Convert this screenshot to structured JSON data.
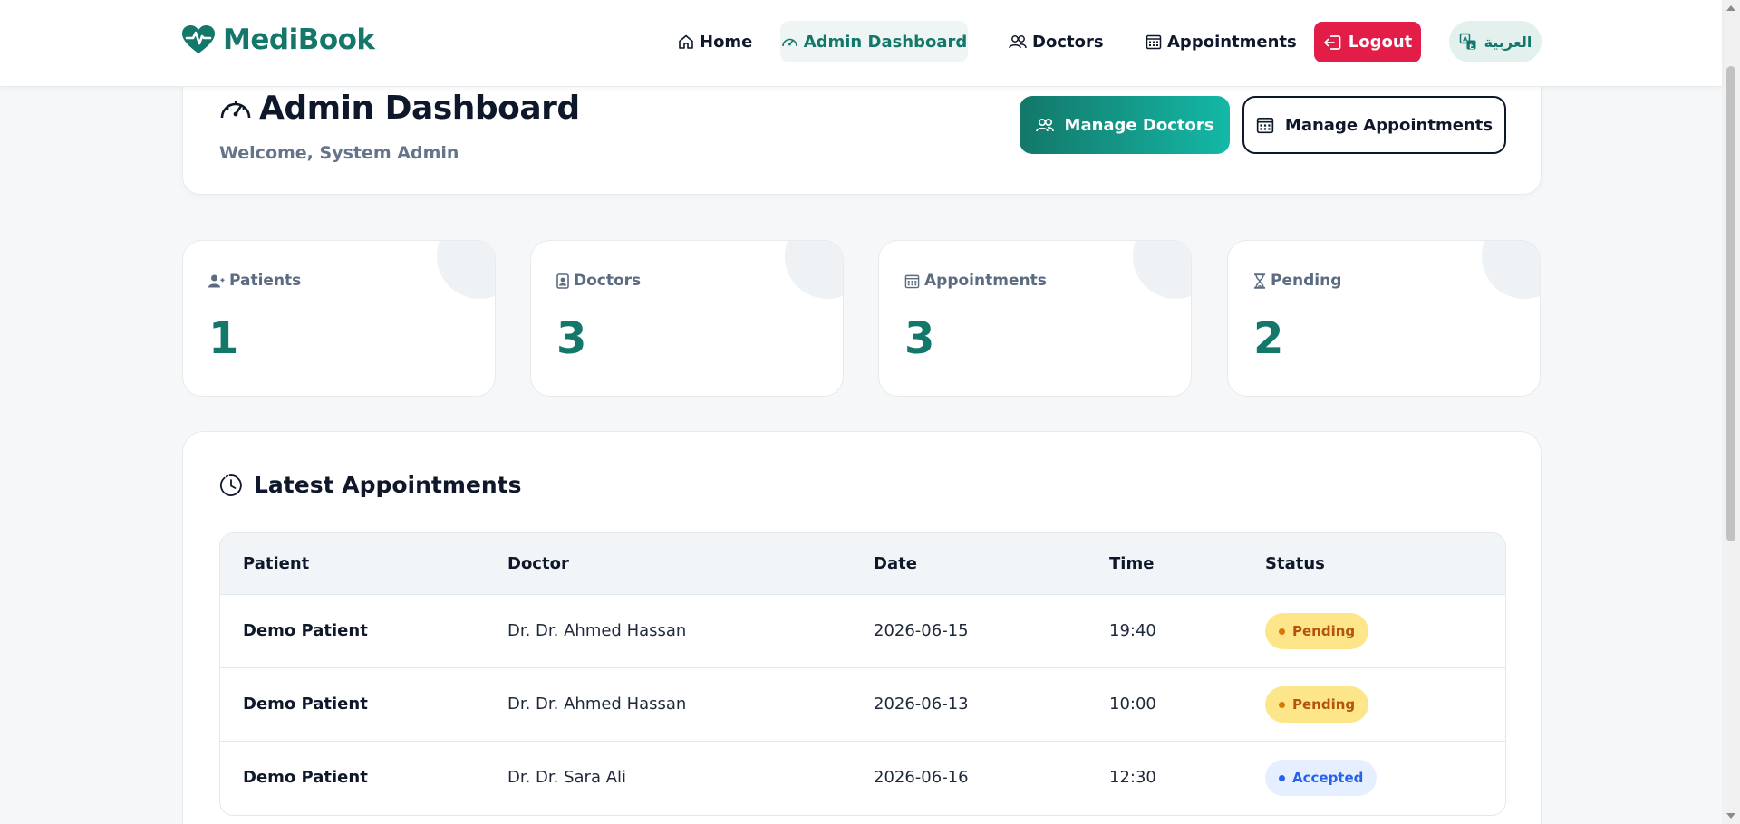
{
  "brand": {
    "name": "MediBook",
    "accent": "#137769"
  },
  "nav": {
    "home": "Home",
    "admin_dashboard": "Admin Dashboard",
    "doctors": "Doctors",
    "appointments": "Appointments",
    "logout": "Logout",
    "language": "العربية"
  },
  "page": {
    "title": "Admin Dashboard",
    "welcome": "Welcome, System Admin",
    "manage_doctors": "Manage Doctors",
    "manage_appointments": "Manage Appointments"
  },
  "stats": [
    {
      "label": "Patients",
      "value": "1",
      "icon": "patient-icon"
    },
    {
      "label": "Doctors",
      "value": "3",
      "icon": "doctor-badge-icon"
    },
    {
      "label": "Appointments",
      "value": "3",
      "icon": "calendar-icon"
    },
    {
      "label": "Pending",
      "value": "2",
      "icon": "hourglass-icon"
    }
  ],
  "latest": {
    "title": "Latest Appointments",
    "columns": [
      "Patient",
      "Doctor",
      "Date",
      "Time",
      "Status"
    ],
    "rows": [
      {
        "patient": "Demo Patient",
        "doctor": "Dr. Dr. Ahmed Hassan",
        "date": "2026-06-15",
        "time": "19:40",
        "status": "Pending"
      },
      {
        "patient": "Demo Patient",
        "doctor": "Dr. Dr. Ahmed Hassan",
        "date": "2026-06-13",
        "time": "10:00",
        "status": "Pending"
      },
      {
        "patient": "Demo Patient",
        "doctor": "Dr. Dr. Sara Ali",
        "date": "2026-06-16",
        "time": "12:30",
        "status": "Accepted"
      }
    ]
  },
  "colors": {
    "logout": "#e11d48",
    "pending_bg": "#fde68a",
    "accepted_bg": "#e6efff",
    "stat_value": "#137769"
  }
}
